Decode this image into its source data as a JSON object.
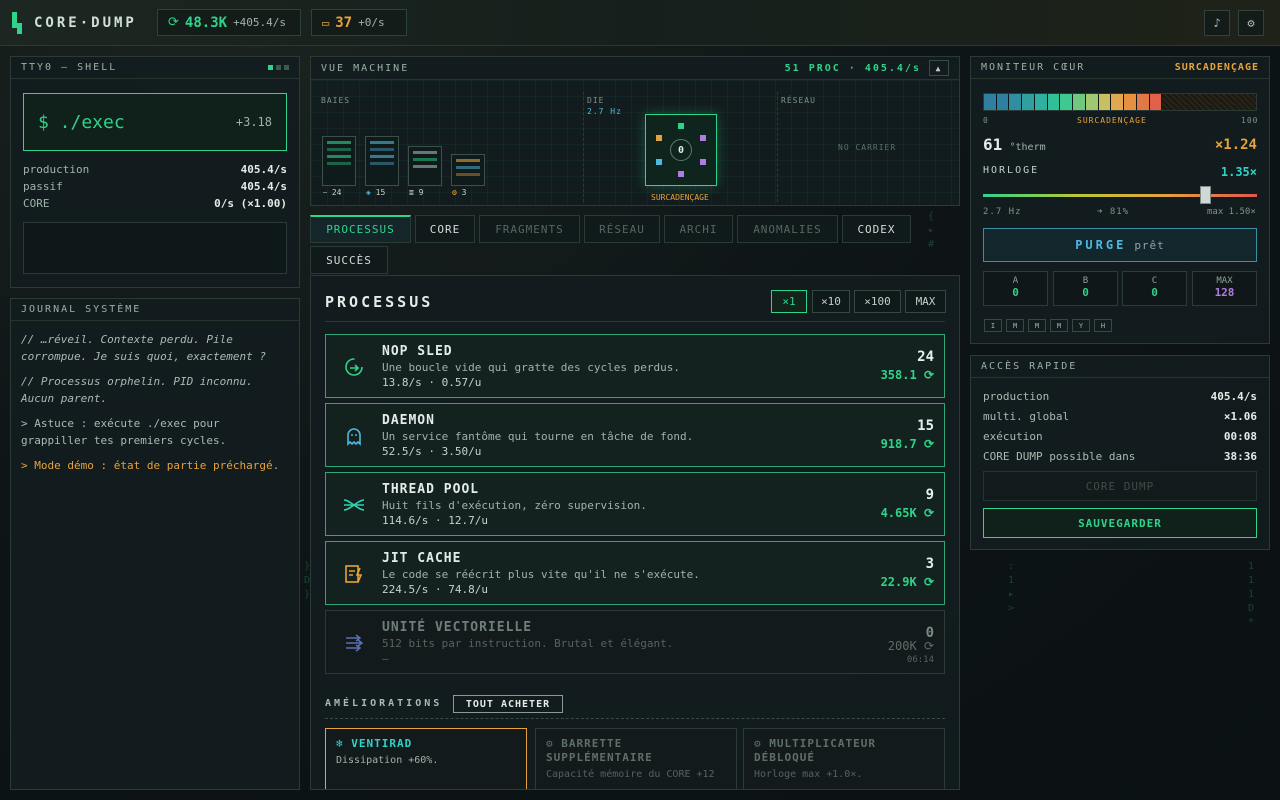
{
  "app": {
    "logo": "CORE·DUMP",
    "cycles": "48.3K",
    "cycles_rate": "+405.4/s",
    "fragments": "37",
    "fragments_rate": "+0/s"
  },
  "shell": {
    "title": "TTY0 — SHELL",
    "exec_label": "$ ./exec",
    "exec_delta": "+3.18",
    "rows": [
      {
        "k": "production",
        "v": "405.4/s"
      },
      {
        "k": "passif",
        "v": "405.4/s"
      },
      {
        "k": "CORE",
        "v": "0/s (×1.00)"
      }
    ]
  },
  "journal": {
    "title": "JOURNAL SYSTÈME",
    "lines": [
      "// …réveil. Contexte perdu. Pile corrompue. Je suis quoi, exactement ?",
      "// Processus orphelin. PID inconnu. Aucun parent.",
      "> Astuce : exécute ./exec pour grappiller tes premiers cycles.",
      "> Mode démo : état de partie préchargé."
    ]
  },
  "machine": {
    "title": "VUE MACHINE",
    "status": "51 PROC · 405.4/s",
    "collapse": "▲",
    "label_racks": "BAIES",
    "label_die": "DIE",
    "die_freq": "2.7 Hz",
    "label_network": "RÉSEAU",
    "no_carrier": "NO CARRIER",
    "overclock": "SURCADENÇAGE",
    "core_value": "0",
    "racks": [
      {
        "icon": "⎯",
        "count": "24"
      },
      {
        "icon": "◈",
        "count": "15"
      },
      {
        "icon": "≣",
        "count": "9"
      },
      {
        "icon": "⚙",
        "count": "3"
      }
    ]
  },
  "tabs": [
    {
      "label": "PROCESSUS",
      "state": "active"
    },
    {
      "label": "CORE",
      "state": "normal"
    },
    {
      "label": "FRAGMENTS",
      "state": "dim"
    },
    {
      "label": "RÉSEAU",
      "state": "dim"
    },
    {
      "label": "ARCHI",
      "state": "dim"
    },
    {
      "label": "ANOMALIES",
      "state": "dim"
    },
    {
      "label": "CODEX",
      "state": "normal"
    },
    {
      "label": "SUCCÈS",
      "state": "normal"
    }
  ],
  "processes": {
    "title": "PROCESSUS",
    "multipliers": [
      "×1",
      "×10",
      "×100",
      "MAX"
    ],
    "items": [
      {
        "name": "NOP SLED",
        "desc": "Une boucle vide qui gratte des cycles perdus.",
        "rate": "13.8/s · 0.57/u",
        "count": "24",
        "cost": "358.1",
        "icon": "nop-sled-icon",
        "color": "#2fd38a"
      },
      {
        "name": "DAEMON",
        "desc": "Un service fantôme qui tourne en tâche de fond.",
        "rate": "52.5/s · 3.50/u",
        "count": "15",
        "cost": "918.7",
        "icon": "ghost-icon",
        "color": "#4fb8e0"
      },
      {
        "name": "THREAD POOL",
        "desc": "Huit fils d'exécution, zéro supervision.",
        "rate": "114.6/s · 12.7/u",
        "count": "9",
        "cost": "4.65K",
        "icon": "threads-icon",
        "color": "#2fd3b0"
      },
      {
        "name": "JIT CACHE",
        "desc": "Le code se réécrit plus vite qu'il ne s'exécute.",
        "rate": "224.5/s · 74.8/u",
        "count": "3",
        "cost": "22.9K",
        "icon": "bolt-file-icon",
        "color": "#e6a23c"
      },
      {
        "name": "UNITÉ VECTORIELLE",
        "desc": "512 bits par instruction. Brutal et élégant.",
        "rate": "—",
        "count": "0",
        "cost": "200K",
        "eta": "06:14",
        "icon": "vector-arrows-icon",
        "color": "#5a6fb0",
        "locked": true
      }
    ],
    "upgrades_title": "AMÉLIORATIONS",
    "buy_all": "TOUT ACHETER",
    "upgrades": [
      {
        "name": "VENTIRAD",
        "desc": "Dissipation +60%.",
        "active": true
      },
      {
        "name": "BARRETTE SUPPLÉMENTAIRE",
        "desc": "Capacité mémoire du CORE +12",
        "active": false
      },
      {
        "name": "MULTIPLICATEUR DÉBLOQUÉ",
        "desc": "Horloge max +1.0×.",
        "active": false
      }
    ]
  },
  "monitor": {
    "title": "MONITEUR CŒUR",
    "state": "SURCADENÇAGE",
    "scale_min": "0",
    "scale_label": "SURCADENÇAGE",
    "scale_max": "100",
    "heat_value": "61",
    "heat_unit": "°therm",
    "heat_mult": "×1.24",
    "clock_label": "HORLOGE",
    "clock_value": "1.35×",
    "clock_min": "2.7 Hz",
    "clock_mid": "➜ 81%",
    "clock_max": "max 1.50×",
    "clock_level": 0.81,
    "purge_label": "PURGE",
    "purge_state": "prêt",
    "slots": [
      {
        "k": "A",
        "v": "0"
      },
      {
        "k": "B",
        "v": "0"
      },
      {
        "k": "C",
        "v": "0"
      },
      {
        "k": "MAX",
        "v": "128"
      }
    ],
    "keys": [
      "I",
      "M",
      "M",
      "M",
      "Y",
      "H"
    ]
  },
  "quick": {
    "title": "ACCÈS RAPIDE",
    "rows": [
      {
        "k": "production",
        "v": "405.4/s"
      },
      {
        "k": "multi. global",
        "v": "×1.06"
      },
      {
        "k": "exécution",
        "v": "00:08"
      },
      {
        "k": "CORE DUMP possible dans",
        "v": "38:36"
      }
    ],
    "core_dump_btn": "CORE DUMP",
    "save_btn": "SAUVEGARDER"
  },
  "colors": {
    "accent": "#2fd38a",
    "warn": "#e6a23c",
    "cyan": "#4fb8e0",
    "purple": "#b07be0"
  }
}
